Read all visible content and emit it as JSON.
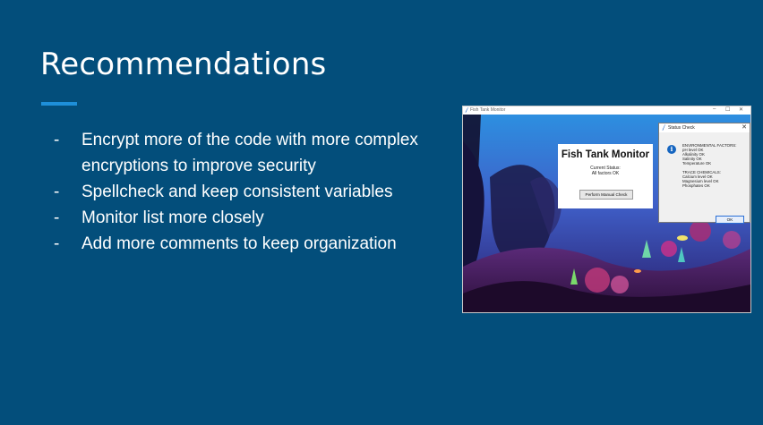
{
  "slide": {
    "title": "Recommendations",
    "bullets": [
      {
        "marker": "-",
        "text": "Encrypt more of the code with more complex encryptions to improve security"
      },
      {
        "marker": "-",
        "text": "Spellcheck and keep consistent variables"
      },
      {
        "marker": "-",
        "text": "Monitor list more closely"
      },
      {
        "marker": "-",
        "text": "Add more comments to keep organization"
      }
    ]
  },
  "screenshot": {
    "main_window": {
      "title": "Fish Tank Monitor",
      "controls": {
        "minimize": "–",
        "maximize": "☐",
        "close": "✕"
      },
      "panel": {
        "heading": "Fish Tank Monitor",
        "status_label": "Current Status:",
        "status_value": "All factors OK",
        "button_label": "Perform Manual Check"
      }
    },
    "dialog": {
      "title": "Status Check",
      "close_glyph": "✕",
      "icon_glyph": "i",
      "env_header": "ENVIRONMENTAL FACTORS:",
      "env_lines": [
        "pH level OK",
        "Alkalinity OK",
        "Salinity OK",
        "Temperature OK"
      ],
      "chem_header": "TRACE CHEMICALS:",
      "chem_lines": [
        "Calcium level OK",
        "Magnesium level OK",
        "Phosphates OK"
      ],
      "ok_label": "OK"
    }
  },
  "colors": {
    "background": "#034e7b",
    "accent_rule": "#1e8fd9",
    "text": "#ffffff"
  }
}
